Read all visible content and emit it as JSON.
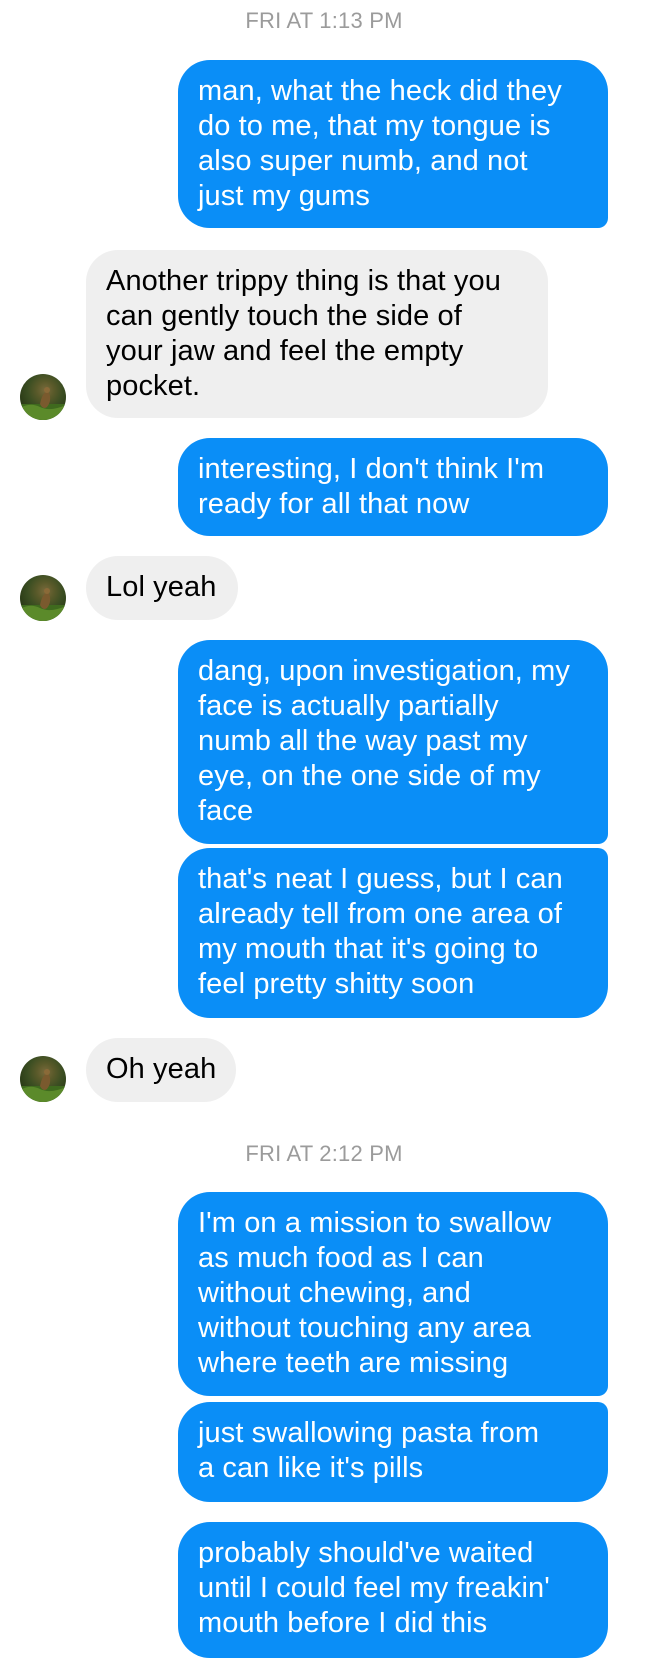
{
  "timestamps": [
    "FRI AT 1:13 PM",
    "FRI AT 2:12 PM"
  ],
  "messages": [
    {
      "sender": "me",
      "lines": [
        "man, what the heck did they",
        "do to me, that my tongue is",
        "also super numb, and not",
        "just my gums"
      ]
    },
    {
      "sender": "them",
      "lines": [
        "Another trippy thing is that you",
        "can gently touch the side of",
        "your jaw and feel the empty",
        "pocket."
      ]
    },
    {
      "sender": "me",
      "lines": [
        "interesting, I don't think I'm",
        "ready for all that now"
      ]
    },
    {
      "sender": "them",
      "lines": [
        "Lol yeah"
      ]
    },
    {
      "sender": "me",
      "lines": [
        "dang, upon investigation, my",
        "face is actually partially",
        "numb all the way past my",
        "eye, on the one side of my",
        "face"
      ]
    },
    {
      "sender": "me",
      "lines": [
        "that's neat I guess, but I can",
        "already tell from one area of",
        "my mouth that it's going to",
        "feel pretty shitty soon"
      ]
    },
    {
      "sender": "them",
      "lines": [
        "Oh yeah"
      ]
    },
    {
      "sender": "me",
      "lines": [
        "I'm on a mission to swallow",
        "as much food as I can",
        "without chewing, and",
        "without touching  any area",
        "where teeth are missing"
      ]
    },
    {
      "sender": "me",
      "lines": [
        "just swallowing pasta from",
        "a can like it's pills"
      ]
    },
    {
      "sender": "me",
      "lines": [
        "probably should've waited",
        "until I could feel my freakin'",
        "mouth before I did this"
      ]
    }
  ],
  "colors": {
    "outgoing_bubble": "#0a8ef7",
    "incoming_bubble": "#efefef",
    "timestamp": "#9b9b9b"
  },
  "icons": {
    "avatar": "contact-avatar-photo"
  }
}
